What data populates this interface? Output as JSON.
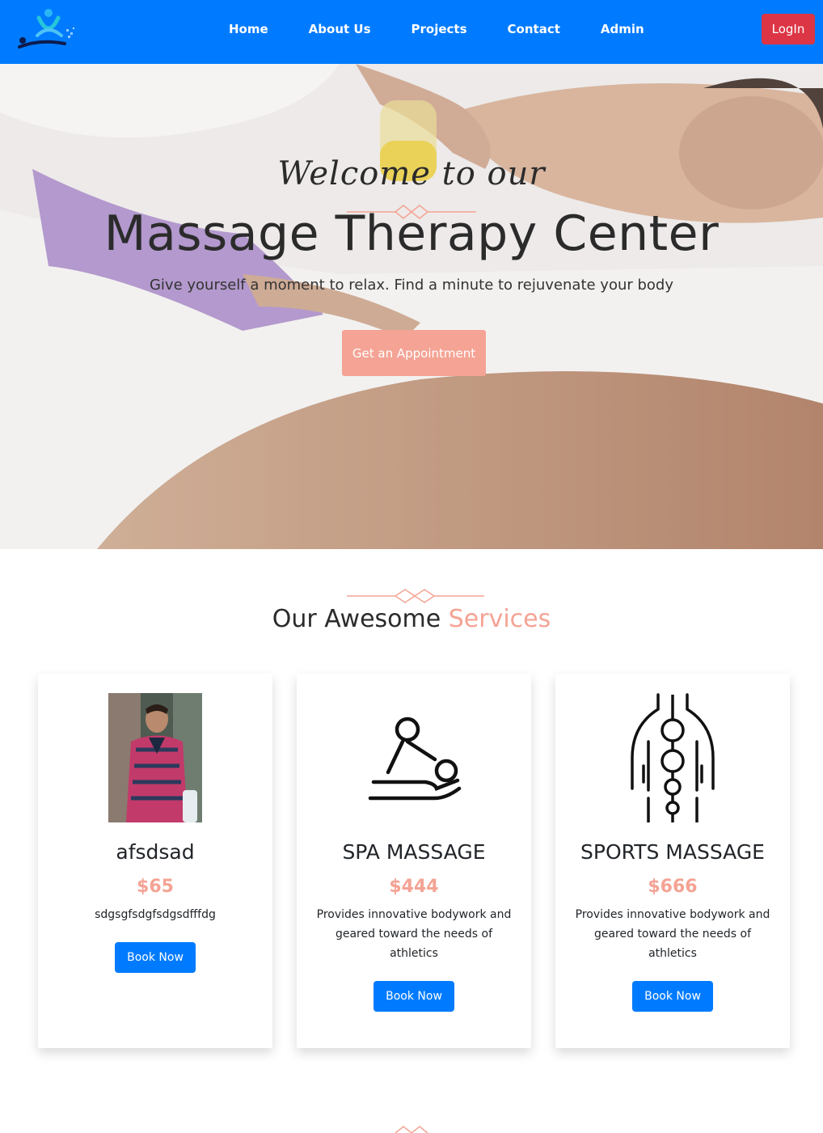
{
  "navbar": {
    "logo_icon": "massage-logo-icon",
    "links": [
      "Home",
      "About Us",
      "Projects",
      "Contact",
      "Admin"
    ],
    "login_label": "LogIn",
    "color": "#007bff",
    "login_color": "#dc3545"
  },
  "hero": {
    "script_text": "Welcome to our",
    "title": "Massage Therapy Center",
    "subtitle": "Give yourself a moment to relax. Find a minute to rejuvenate your body",
    "cta_label": "Get an Appointment",
    "accent_color": "#f4a394"
  },
  "services": {
    "title_main": "Our Awesome",
    "title_accent": "Services",
    "cards": [
      {
        "title": "afsdsad",
        "price": "$65",
        "description": "sdgsgfsdgfsdgsdfffdg",
        "button": "Book Now",
        "media": "person-photo"
      },
      {
        "title": "SPA MASSAGE",
        "price": "$444",
        "description": "Provides innovative bodywork and geared toward the needs of athletics",
        "button": "Book Now",
        "media": "spa-massage-icon"
      },
      {
        "title": "SPORTS MASSAGE",
        "price": "$666",
        "description": "Provides innovative bodywork and geared toward the needs of athletics",
        "button": "Book Now",
        "media": "spine-icon"
      }
    ]
  }
}
